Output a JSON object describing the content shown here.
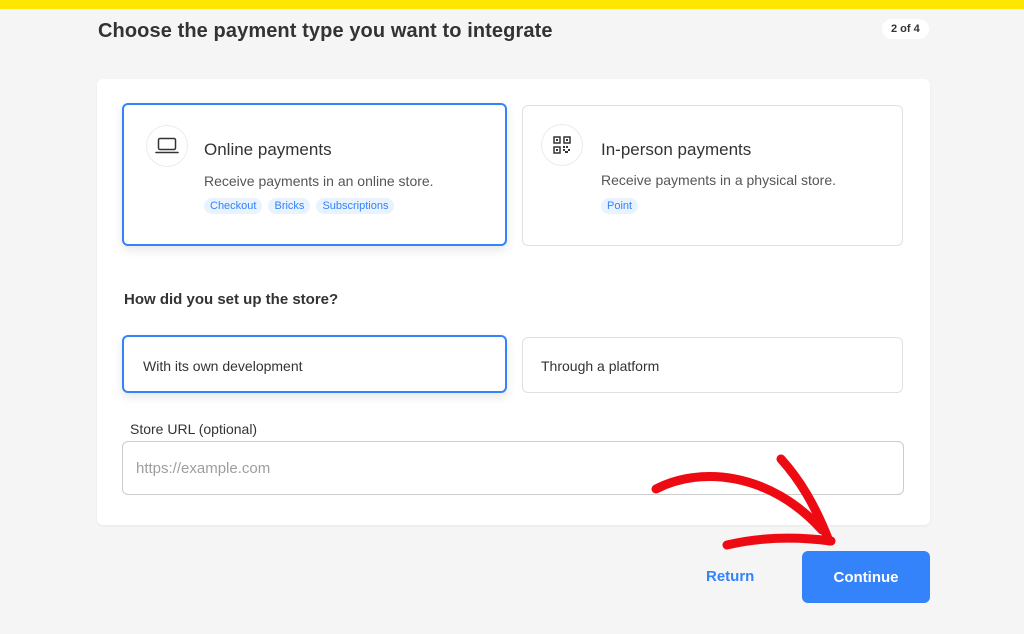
{
  "header": {
    "title": "Choose the payment type you want to integrate",
    "step_indicator": "2 of 4",
    "accent_color": "#ffe600"
  },
  "payment_types": {
    "selected": "online",
    "options": [
      {
        "id": "online",
        "icon": "laptop-icon",
        "title": "Online payments",
        "description": "Receive payments in an online store.",
        "tags": [
          "Checkout",
          "Bricks",
          "Subscriptions"
        ]
      },
      {
        "id": "in-person",
        "icon": "qr-code-icon",
        "title": "In-person payments",
        "description": "Receive payments in a physical store.",
        "tags": [
          "Point"
        ]
      }
    ]
  },
  "store_setup": {
    "question": "How did you set up the store?",
    "selected": "own-development",
    "options": [
      {
        "id": "own-development",
        "label": "With its own development"
      },
      {
        "id": "platform",
        "label": "Through a platform"
      }
    ]
  },
  "store_url": {
    "label": "Store URL (optional)",
    "placeholder": "https://example.com",
    "value": ""
  },
  "actions": {
    "return_label": "Return",
    "continue_label": "Continue",
    "primary_color": "#3483fa"
  },
  "annotation": {
    "arrow_color": "#ee0a12"
  }
}
